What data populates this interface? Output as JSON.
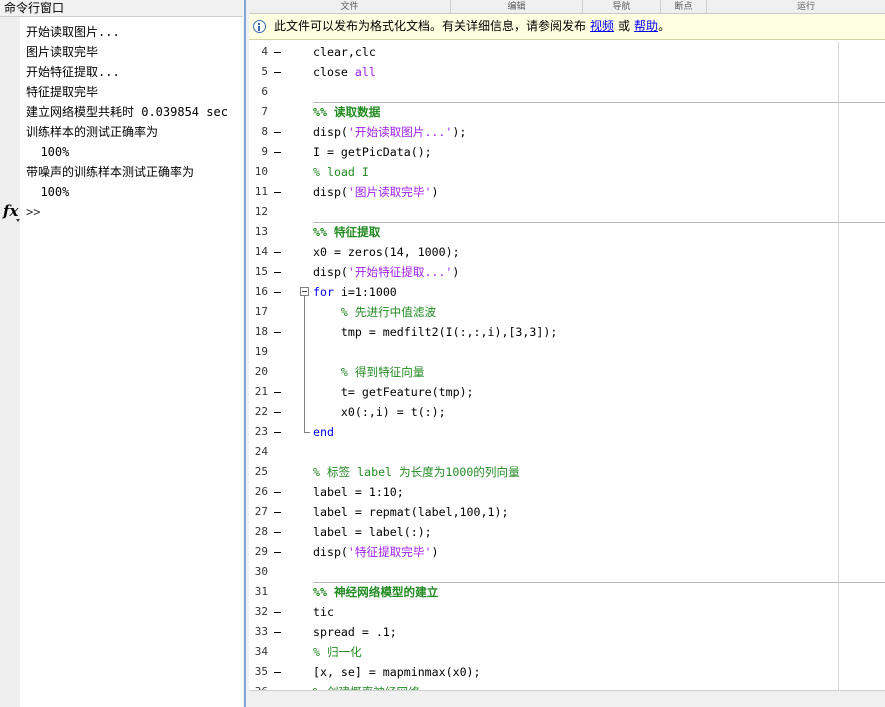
{
  "command_window": {
    "title": "命令行窗口",
    "output": [
      "开始读取图片...",
      "图片读取完毕",
      "开始特征提取...",
      "特征提取完毕",
      "建立网络模型共耗时 0.039854 sec",
      "训练样本的测试正确率为",
      "  100%",
      "带噪声的训练样本测试正确率为",
      "  100%"
    ],
    "fx_label": "fx",
    "prompt": ">>"
  },
  "toolstrip": {
    "sections": [
      "文件",
      "编辑",
      "导航",
      "断点",
      "运行"
    ]
  },
  "info_bar": {
    "icon": "info-icon",
    "message": "此文件可以发布为格式化文档。有关详细信息，请参阅发布",
    "video_link": "视频",
    "or_text": "或",
    "help_link": "帮助",
    "end_punct": "。"
  },
  "editor": {
    "lines": [
      {
        "num": "4",
        "exec": true,
        "tokens": [
          {
            "k": "plain",
            "t": "clear,clc"
          }
        ]
      },
      {
        "num": "5",
        "exec": true,
        "tokens": [
          {
            "k": "plain",
            "t": "close "
          },
          {
            "k": "string",
            "t": "all"
          }
        ]
      },
      {
        "num": "6",
        "tokens": []
      },
      {
        "num": "7",
        "cell_break": true,
        "tokens": [
          {
            "k": "cell_title",
            "t": "%% 读取数据"
          }
        ]
      },
      {
        "num": "8",
        "exec": true,
        "tokens": [
          {
            "k": "plain",
            "t": "disp("
          },
          {
            "k": "string",
            "t": "'开始读取图片...'"
          },
          {
            "k": "plain",
            "t": ");"
          }
        ]
      },
      {
        "num": "9",
        "exec": true,
        "tokens": [
          {
            "k": "plain",
            "t": "I = getPicData();"
          }
        ]
      },
      {
        "num": "10",
        "tokens": [
          {
            "k": "comment",
            "t": "% load I"
          }
        ]
      },
      {
        "num": "11",
        "exec": true,
        "tokens": [
          {
            "k": "plain",
            "t": "disp("
          },
          {
            "k": "string",
            "t": "'图片读取完毕'"
          },
          {
            "k": "plain",
            "t": ")"
          }
        ]
      },
      {
        "num": "12",
        "tokens": []
      },
      {
        "num": "13",
        "cell_break": true,
        "tokens": [
          {
            "k": "cell_title",
            "t": "%% 特征提取"
          }
        ]
      },
      {
        "num": "14",
        "exec": true,
        "tokens": [
          {
            "k": "plain",
            "t": "x0 = zeros(14, 1000);"
          }
        ]
      },
      {
        "num": "15",
        "exec": true,
        "tokens": [
          {
            "k": "plain",
            "t": "disp("
          },
          {
            "k": "string",
            "t": "'开始特征提取...'"
          },
          {
            "k": "plain",
            "t": ")"
          }
        ]
      },
      {
        "num": "16",
        "exec": true,
        "fold": "start",
        "tokens": [
          {
            "k": "keyword",
            "t": "for"
          },
          {
            "k": "plain",
            "t": " i=1:1000"
          }
        ]
      },
      {
        "num": "17",
        "tokens": [
          {
            "k": "comment",
            "t": "    % 先进行中值滤波"
          }
        ]
      },
      {
        "num": "18",
        "exec": true,
        "tokens": [
          {
            "k": "plain",
            "t": "    tmp = medfilt2(I(:,:,i),[3,3]);"
          }
        ]
      },
      {
        "num": "19",
        "tokens": []
      },
      {
        "num": "20",
        "tokens": [
          {
            "k": "comment",
            "t": "    % 得到特征向量"
          }
        ]
      },
      {
        "num": "21",
        "exec": true,
        "tokens": [
          {
            "k": "plain",
            "t": "    t= getFeature(tmp);"
          }
        ]
      },
      {
        "num": "22",
        "exec": true,
        "tokens": [
          {
            "k": "plain",
            "t": "    x0(:,i) = t(:);"
          }
        ]
      },
      {
        "num": "23",
        "exec": true,
        "fold": "end",
        "tokens": [
          {
            "k": "keyword",
            "t": "end"
          }
        ]
      },
      {
        "num": "24",
        "tokens": []
      },
      {
        "num": "25",
        "tokens": [
          {
            "k": "comment",
            "t": "% 标签 label 为长度为1000的列向量"
          }
        ]
      },
      {
        "num": "26",
        "exec": true,
        "tokens": [
          {
            "k": "plain",
            "t": "label = 1:10;"
          }
        ]
      },
      {
        "num": "27",
        "exec": true,
        "tokens": [
          {
            "k": "plain",
            "t": "label = repmat(label,100,1);"
          }
        ]
      },
      {
        "num": "28",
        "exec": true,
        "tokens": [
          {
            "k": "plain",
            "t": "label = label(:);"
          }
        ]
      },
      {
        "num": "29",
        "exec": true,
        "tokens": [
          {
            "k": "plain",
            "t": "disp("
          },
          {
            "k": "string",
            "t": "'特征提取完毕'"
          },
          {
            "k": "plain",
            "t": ")"
          }
        ]
      },
      {
        "num": "30",
        "tokens": []
      },
      {
        "num": "31",
        "cell_break": true,
        "tokens": [
          {
            "k": "cell_title",
            "t": "%% 神经网络模型的建立"
          }
        ]
      },
      {
        "num": "32",
        "exec": true,
        "tokens": [
          {
            "k": "plain",
            "t": "tic"
          }
        ]
      },
      {
        "num": "33",
        "exec": true,
        "tokens": [
          {
            "k": "plain",
            "t": "spread = .1;"
          }
        ]
      },
      {
        "num": "34",
        "tokens": [
          {
            "k": "comment",
            "t": "% 归一化"
          }
        ]
      },
      {
        "num": "35",
        "exec": true,
        "tokens": [
          {
            "k": "plain",
            "t": "[x, se] = mapminmax(x0);"
          }
        ]
      },
      {
        "num": "36",
        "tokens": [
          {
            "k": "comment",
            "t": "% 创建概率神经网络"
          }
        ]
      }
    ]
  },
  "colors": {
    "syntax": {
      "plain": "#000000",
      "keyword": "#0000FF",
      "string": "#A020F0",
      "comment": "#228B22",
      "cell_title": "#228B22"
    },
    "link": "#0000FF",
    "info_bar_bg": "#FFFFE1",
    "splitter_accent": "#7EA6D6"
  }
}
